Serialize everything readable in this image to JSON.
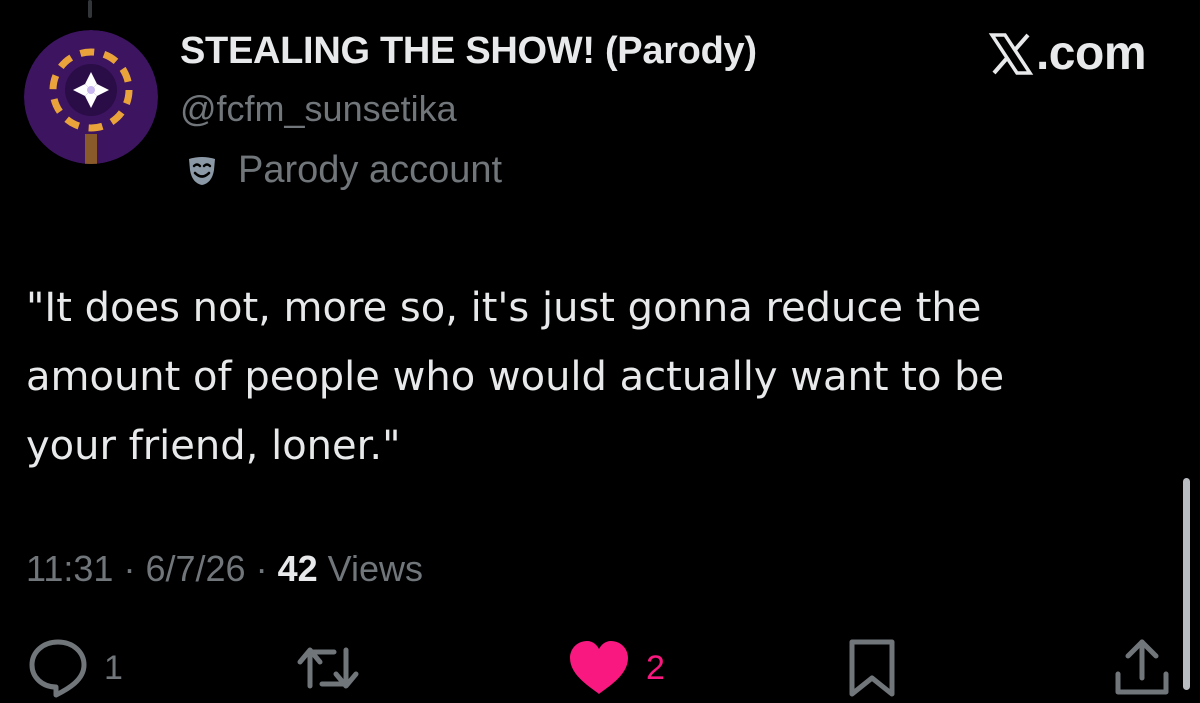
{
  "tweet": {
    "display_name": "STEALING THE SHOW! (Parody)",
    "handle": "@fcfm_sunsetika",
    "parody_label": "Parody account",
    "text": "\"It does not, more so, it's just gonna reduce the\namount of people who would actually want to be\nyour friend, loner.\"",
    "time": "11:31",
    "date": "6/7/26",
    "separator": "·",
    "views_count": "42",
    "views_label": "Views"
  },
  "brand": {
    "text": ".com"
  },
  "actions": {
    "reply_count": "1",
    "like_count": "2"
  },
  "icons": {
    "brand": "x-logo-icon",
    "parody": "theater-mask-icon",
    "reply": "reply-icon",
    "repost": "repost-icon",
    "like": "heart-icon",
    "bookmark": "bookmark-icon",
    "share": "share-icon"
  },
  "colors": {
    "background": "#000000",
    "text_primary": "#e7e9ea",
    "text_secondary": "#71767b",
    "like": "#f91880",
    "avatar_bg": "#3c1460",
    "avatar_accent": "#e9a33a"
  }
}
